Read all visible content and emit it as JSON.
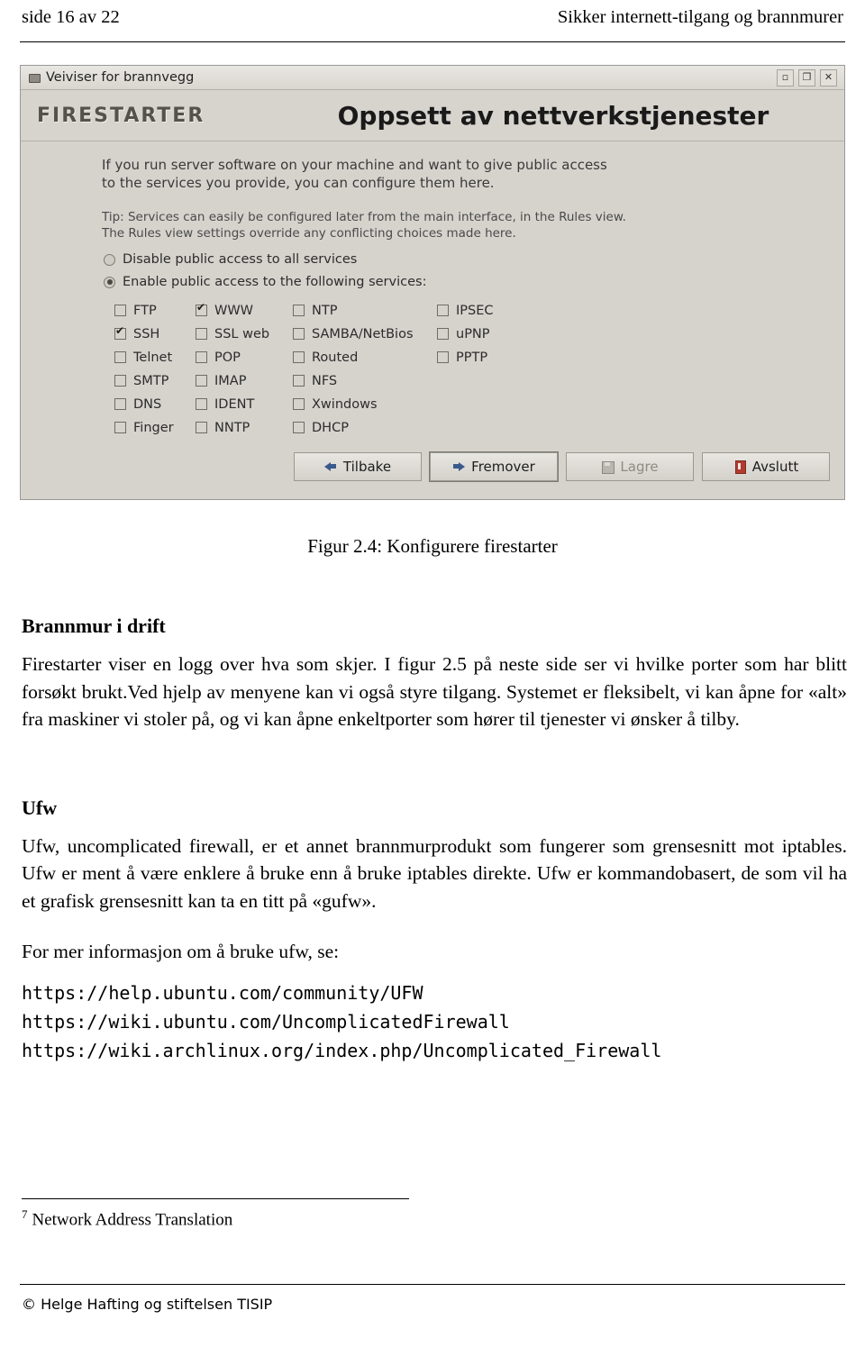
{
  "header": {
    "left": "side 16 av 22",
    "right": "Sikker internett-tilgang og brannmurer"
  },
  "firestarter": {
    "window_title": "Veiviser for brannvegg",
    "titlebar_buttons": [
      "▫",
      "❐",
      "✕"
    ],
    "logo": "FIRESTARTER",
    "banner_title": "Oppsett av nettverkstjenester",
    "intro_line1": "If you run server software on your machine and want to give public access",
    "intro_line2": "to the services you provide, you can configure them here.",
    "tip_line1": "Tip: Services can easily be configured later from the main interface, in the Rules view.",
    "tip_line2": "The Rules view settings override any conflicting choices made here.",
    "radio_disable": "Disable public access to all services",
    "radio_enable": "Enable public access to the following services:",
    "radio_selected": "enable",
    "services": [
      {
        "label": "FTP",
        "checked": false
      },
      {
        "label": "WWW",
        "checked": true
      },
      {
        "label": "NTP",
        "checked": false
      },
      {
        "label": "IPSEC",
        "checked": false
      },
      {
        "label": "SSH",
        "checked": true
      },
      {
        "label": "SSL web",
        "checked": false
      },
      {
        "label": "SAMBA/NetBios",
        "checked": false
      },
      {
        "label": "uPNP",
        "checked": false
      },
      {
        "label": "Telnet",
        "checked": false
      },
      {
        "label": "POP",
        "checked": false
      },
      {
        "label": "Routed",
        "checked": false
      },
      {
        "label": "PPTP",
        "checked": false
      },
      {
        "label": "SMTP",
        "checked": false
      },
      {
        "label": "IMAP",
        "checked": false
      },
      {
        "label": "NFS",
        "checked": false
      },
      {
        "label": "",
        "checked": null
      },
      {
        "label": "DNS",
        "checked": false
      },
      {
        "label": "IDENT",
        "checked": false
      },
      {
        "label": "Xwindows",
        "checked": false
      },
      {
        "label": "",
        "checked": null
      },
      {
        "label": "Finger",
        "checked": false
      },
      {
        "label": "NNTP",
        "checked": false
      },
      {
        "label": "DHCP",
        "checked": false
      },
      {
        "label": "",
        "checked": null
      }
    ],
    "buttons": [
      {
        "label": "Tilbake",
        "icon": "arrow-left-icon",
        "state": "normal"
      },
      {
        "label": "Fremover",
        "icon": "arrow-right-icon",
        "state": "focus"
      },
      {
        "label": "Lagre",
        "icon": "save-icon",
        "state": "disabled"
      },
      {
        "label": "Avslutt",
        "icon": "quit-icon",
        "state": "normal"
      }
    ]
  },
  "figure_caption": "Figur 2.4: Konfigurere firestarter",
  "sections": {
    "brannmur_heading": "Brannmur i drift",
    "brannmur_para": "Firestarter viser en logg over hva som skjer. I figur 2.5 på neste side ser vi hvilke porter som har blitt forsøkt brukt.Ved hjelp av menyene kan vi også styre tilgang. Systemet er fleksibelt, vi kan åpne for «alt» fra maskiner vi stoler på, og vi kan åpne enkeltporter som hører til tjenester vi ønsker å tilby.",
    "ufw_heading": "Ufw",
    "ufw_para1": "Ufw, uncomplicated firewall, er et annet brannmurprodukt som fungerer som grensesnitt mot iptables. Ufw er ment å være enklere å bruke enn å bruke iptables direkte. Ufw er kommandobasert, de som vil ha et grafisk grensesnitt kan ta en titt på «gufw».",
    "ufw_para2": "For mer informasjon om å bruke ufw, se:",
    "urls": [
      "https://help.ubuntu.com/community/UFW",
      "https://wiki.ubuntu.com/UncomplicatedFirewall",
      "https://wiki.archlinux.org/index.php/Uncomplicated_Firewall"
    ]
  },
  "footnote": {
    "marker": "7",
    "text": "Network Address Translation"
  },
  "footer": "© Helge Hafting og stiftelsen TISIP"
}
